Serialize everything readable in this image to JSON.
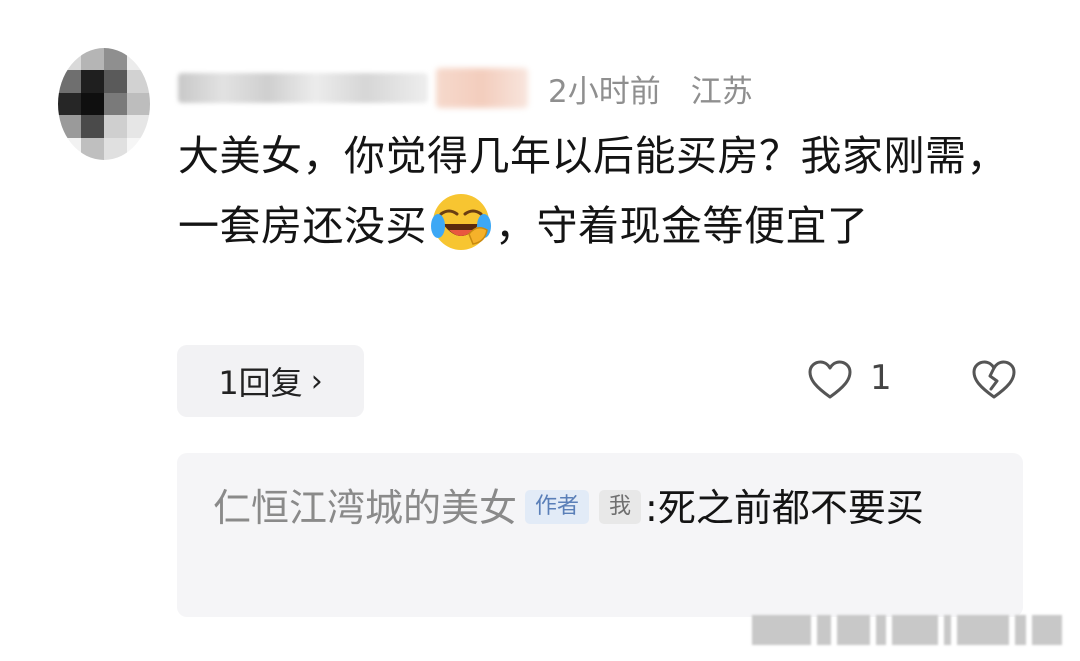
{
  "comment": {
    "time": "2小时前",
    "location": "江苏",
    "text_before_emoji": "大美女，你觉得几年以后能买房？我家刚需，一套房还没买",
    "emoji": "laughing-crying-emoji",
    "text_after_emoji": "，守着现金等便宜了",
    "reply_button_label": "1回复",
    "reply_chevron": "›",
    "like_count": "1"
  },
  "reply_preview": {
    "author": "仁恒江湾城的美女",
    "author_tag": "作者",
    "me_tag": "我",
    "colon": ":",
    "text": "死之前都不要买"
  },
  "colors": {
    "meta_text": "#8f8f8f",
    "reply_box_bg": "#f5f5f7",
    "author_tag_bg": "#e2ebf7",
    "author_tag_fg": "#5a7fb8"
  },
  "icons": {
    "like": "heart-outline-icon",
    "dislike": "broken-heart-icon"
  }
}
